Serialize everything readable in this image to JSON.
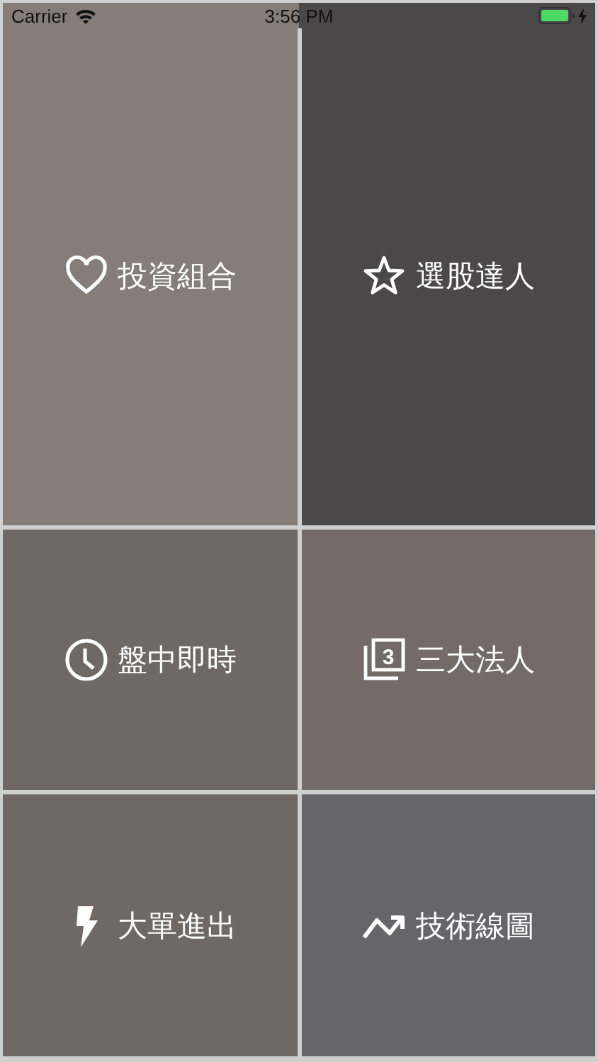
{
  "status_bar": {
    "carrier": "Carrier",
    "time": "3:56 PM"
  },
  "tiles": [
    {
      "label": "投資組合",
      "color": "#877d78"
    },
    {
      "label": "選股達人",
      "color": "#4a4849"
    },
    {
      "label": "盤中即時",
      "color": "#706865"
    },
    {
      "label": "三大法人",
      "icon_text": "3",
      "color": "#746b68"
    },
    {
      "label": "大單進出",
      "color": "#706865"
    },
    {
      "label": "技術線圖",
      "color": "#666568"
    }
  ]
}
